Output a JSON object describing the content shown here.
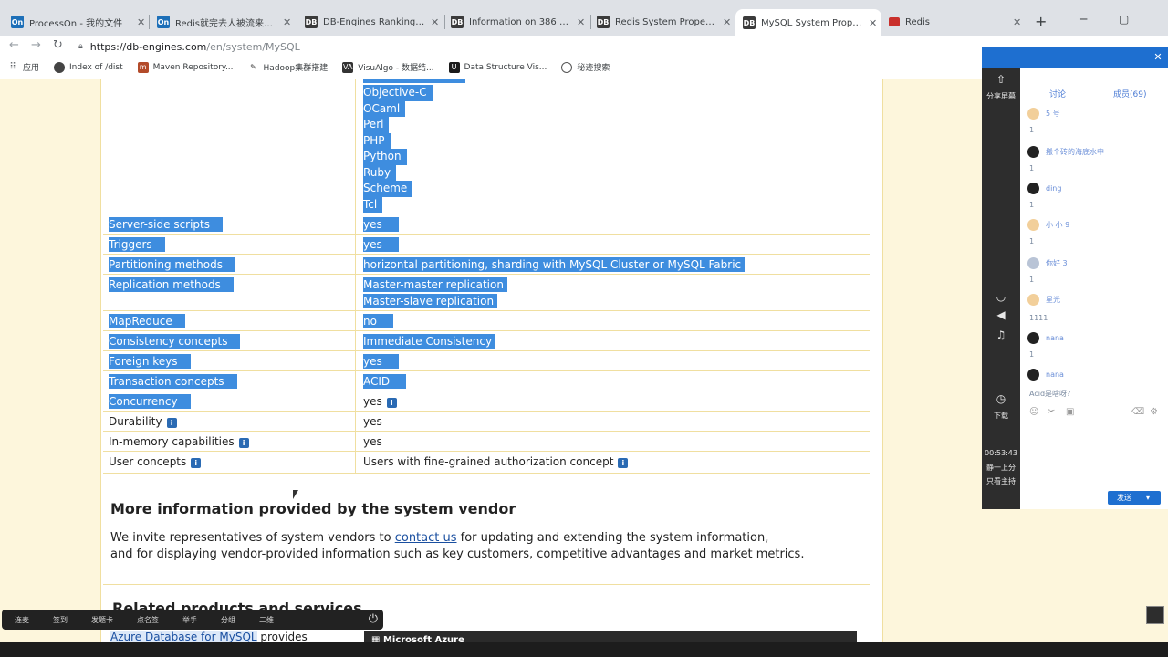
{
  "browser": {
    "tabs": [
      {
        "label": "ProcessOn - 我的文件",
        "icon": "processon-icon",
        "fav": "On"
      },
      {
        "label": "Redis就完去人被流来者 - P",
        "icon": "processon-icon",
        "fav": "On"
      },
      {
        "label": "DB-Engines Ranking - po",
        "icon": "db-engines-icon",
        "fav": "DB"
      },
      {
        "label": "Information on 386 Datab",
        "icon": "db-engines-icon",
        "fav": "DB"
      },
      {
        "label": "Redis System Properties",
        "icon": "db-engines-icon",
        "fav": "DB"
      },
      {
        "label": "MySQL System Properties",
        "icon": "db-engines-icon",
        "fav": "DB"
      },
      {
        "label": "Redis",
        "icon": "redis-icon",
        "fav": ""
      }
    ],
    "new_tab": "+",
    "url_host": "https://db-engines.com",
    "url_path": "/en/system/MySQL",
    "bookmarks": [
      {
        "label": "应用",
        "icon": "apps-grid-icon"
      },
      {
        "label": "Index of /dist",
        "icon": "globe-icon"
      },
      {
        "label": "Maven Repository...",
        "icon": "maven-icon"
      },
      {
        "label": "Hadoop集群搭建",
        "icon": "hadoop-icon"
      },
      {
        "label": "VisuAlgo - 数据结...",
        "icon": "visualgo-icon"
      },
      {
        "label": "Data Structure Vis...",
        "icon": "usf-icon"
      },
      {
        "label": "秘迹搜索",
        "icon": "search-engine-icon"
      }
    ]
  },
  "spec": {
    "languages": [
      "Objective-C",
      "OCaml",
      "Perl",
      "PHP",
      "Python",
      "Ruby",
      "Scheme",
      "Tcl"
    ],
    "rows": [
      {
        "key": "Server-side scripts",
        "values": [
          "yes"
        ]
      },
      {
        "key": "Triggers",
        "values": [
          "yes"
        ]
      },
      {
        "key": "Partitioning methods",
        "values": [
          "horizontal partitioning, sharding with MySQL Cluster or MySQL Fabric"
        ]
      },
      {
        "key": "Replication methods",
        "values": [
          "Master-master replication",
          "Master-slave replication"
        ]
      },
      {
        "key": "MapReduce",
        "values": [
          "no"
        ]
      },
      {
        "key": "Consistency concepts",
        "values": [
          "Immediate Consistency"
        ]
      },
      {
        "key": "Foreign keys",
        "values": [
          "yes"
        ]
      },
      {
        "key": "Transaction concepts",
        "values": [
          "ACID"
        ]
      },
      {
        "key": "Concurrency",
        "values": [
          "yes"
        ]
      },
      {
        "key": "Durability",
        "values": [
          "yes"
        ]
      },
      {
        "key": "In-memory capabilities",
        "values": [
          "yes"
        ]
      },
      {
        "key": "User concepts",
        "values": [
          "Users with fine-grained authorization concept"
        ]
      }
    ]
  },
  "vendor": {
    "heading": "More information provided by the system vendor",
    "text_before": "We invite representatives of system vendors to ",
    "link": "contact us",
    "text_after": " for updating and extending the system information,",
    "line2": "and for displaying vendor-provided information such as key customers, competitive advantages and market metrics."
  },
  "related": {
    "heading": "Related products and services",
    "azure_link": "Azure Database for MySQL",
    "azure_rest": " provides",
    "ad_text": "Microsoft Azure"
  },
  "meeting": {
    "share_label": "分享屏幕",
    "tab_chat": "讨论",
    "tab_members": "成员(69)",
    "time": "00:53:43",
    "status_line1": "静一上分",
    "status_line2": "只看主持",
    "chat": [
      {
        "name": "5 号",
        "msg": "1"
      },
      {
        "name": "搬个砖的海底水中",
        "msg": "1"
      },
      {
        "name": "ding",
        "msg": "1"
      },
      {
        "name": "小 小 9",
        "msg": "1"
      },
      {
        "name": "你好 3",
        "msg": "1"
      },
      {
        "name": "星光",
        "msg": "1111"
      },
      {
        "name": "nana",
        "msg": "1"
      },
      {
        "name": "nana",
        "msg": "Acid是啥呀?"
      }
    ],
    "send": "发送",
    "download_label": "下载"
  },
  "toolbar": {
    "items": [
      "连麦",
      "签到",
      "发题卡",
      "点名签",
      "举手",
      "分组",
      "二维"
    ]
  }
}
